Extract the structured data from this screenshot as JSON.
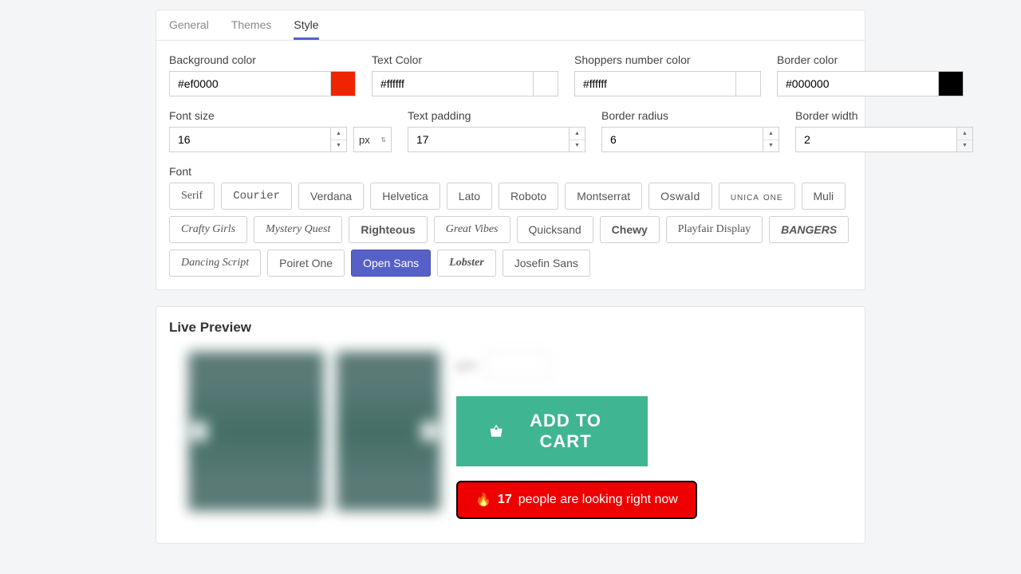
{
  "tabs": {
    "general": "General",
    "themes": "Themes",
    "style": "Style"
  },
  "labels": {
    "bg": "Background color",
    "text": "Text Color",
    "shoppers": "Shoppers number color",
    "border": "Border color",
    "fontsize": "Font size",
    "padding": "Text padding",
    "radius": "Border radius",
    "bwidth": "Border width",
    "font": "Font"
  },
  "values": {
    "bg": "#ef0000",
    "text": "#ffffff",
    "shoppers": "#ffffff",
    "border": "#000000",
    "fontsize": "16",
    "unit": "px",
    "padding": "17",
    "radius": "6",
    "bwidth": "2"
  },
  "swatches": {
    "bg": "#ef2400",
    "text": "#ffffff",
    "shoppers": "#ffffff",
    "border": "#000000"
  },
  "fonts": [
    "Serif",
    "Courier",
    "Verdana",
    "Helvetica",
    "Lato",
    "Roboto",
    "Montserrat",
    "Oswald",
    "unica one",
    "Muli",
    "Crafty Girls",
    "Mystery Quest",
    "Righteous",
    "Great Vibes",
    "Quicksand",
    "Chewy",
    "Playfair Display",
    "BANGERS",
    "Dancing Script",
    "Poiret One",
    "Open Sans",
    "Lobster",
    "Josefin Sans"
  ],
  "selected_font": "Open Sans",
  "preview": {
    "title": "Live Preview",
    "qty_label": "QTY",
    "atc": "ADD TO CART",
    "notice_emoji": "🔥",
    "notice_count": "17",
    "notice_text": "people are looking right now"
  }
}
